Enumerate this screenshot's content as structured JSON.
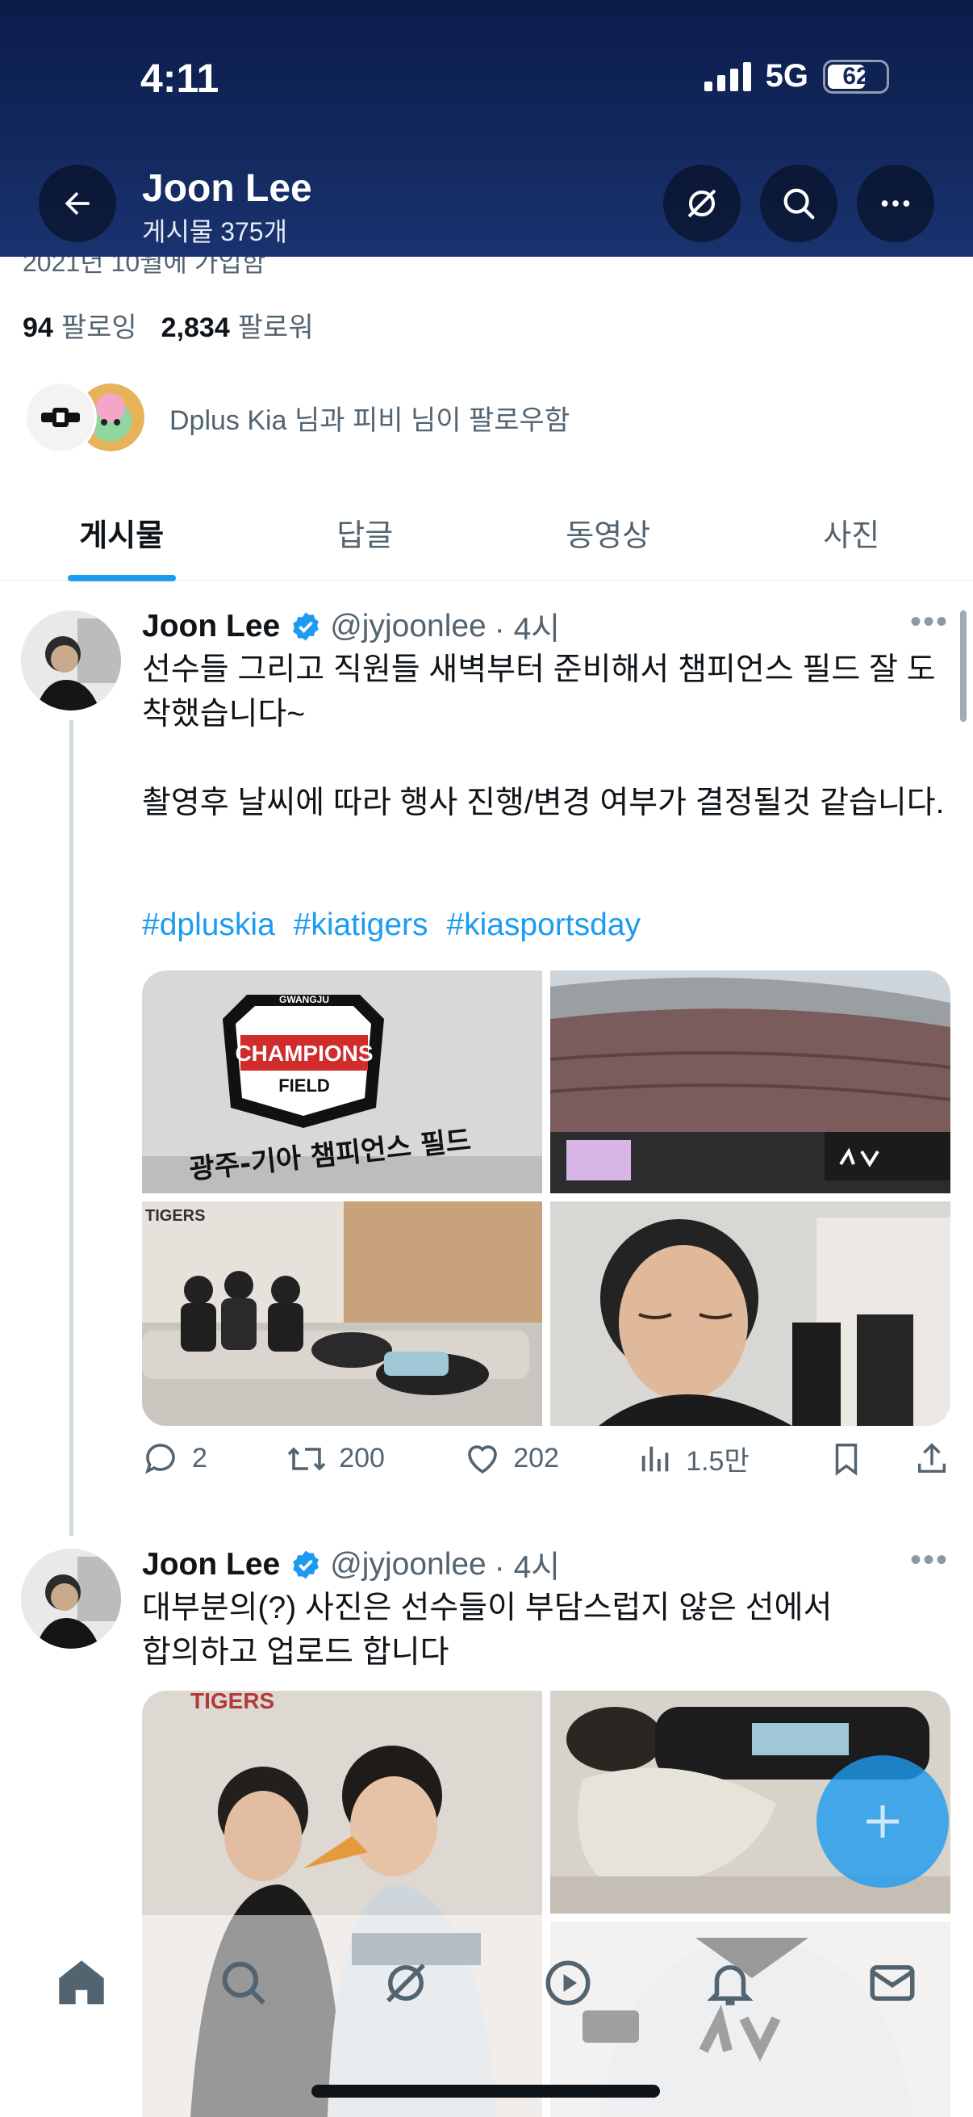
{
  "status_bar": {
    "time": "4:11",
    "network": "5G",
    "battery": "62"
  },
  "header": {
    "name": "Joon Lee",
    "posts_count": "게시물 375개"
  },
  "profile": {
    "joined_partial": "2021년 10월에 가입함",
    "following_count": "94",
    "following_label": "팔로잉",
    "followers_count": "2,834",
    "followers_label": "팔로워",
    "mutual_text": "Dplus Kia 님과 피비 님이 팔로우함"
  },
  "tabs": [
    {
      "label": "게시물",
      "active": true
    },
    {
      "label": "답글",
      "active": false
    },
    {
      "label": "동영상",
      "active": false
    },
    {
      "label": "사진",
      "active": false
    }
  ],
  "posts": [
    {
      "author": "Joon Lee",
      "handle": "@jyjoonlee",
      "time": "· 4시",
      "text": "선수들 그리고 직원들 새벽부터 준비해서 챔피언스 필드 잘 도착했습니다~\n\n촬영후 날씨에 따라 행사 진행/변경 여부가 결정될것 같습니다.",
      "hashtags": [
        "#dpluskia",
        "#kiatigers",
        "#kiasportsday"
      ],
      "photo_texts": {
        "sign_top": "GWANGJU",
        "sign_main": "CHAMPIONS",
        "sign_field": "FIELD",
        "wall_text": "광주-기아 챔피언스 필드"
      },
      "replies": "2",
      "reposts": "200",
      "likes": "202",
      "views": "1.5만"
    },
    {
      "author": "Joon Lee",
      "handle": "@jyjoonlee",
      "time": "· 4시",
      "text": "대부분의(?) 사진은 선수들이 부담스럽지 않은 선에서\n합의하고 업로드 합니다"
    }
  ],
  "colors": {
    "accent": "#1d9bf0",
    "header_bg": "#13295f",
    "text_secondary": "#536471"
  }
}
